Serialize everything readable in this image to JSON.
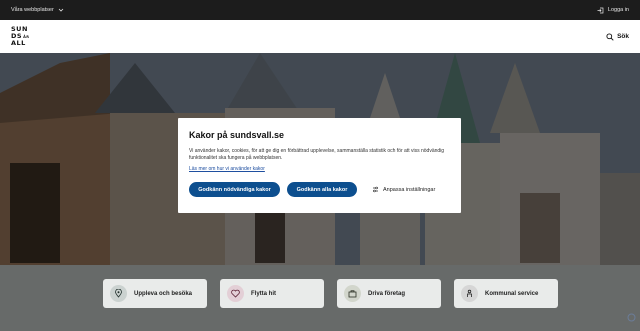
{
  "topbar": {
    "sites_label": "Våra webbplatser",
    "login_label": "Logga in"
  },
  "header": {
    "logo_lines": [
      "SUN",
      "DS",
      "ALL"
    ],
    "logo_small": "ÅR",
    "search_label": "Sök"
  },
  "modal": {
    "title": "Kakor på sundsvall.se",
    "body": "Vi använder kakor, cookies, för att ge dig en förbättrad upplevelse, sammanställa statistik och för att viss nödvändig funktionalitet ska fungera på webbplatsen.",
    "link": "Läs mer om hur vi använder kakor",
    "accept_necessary": "Godkänn nödvändiga kakor",
    "accept_all": "Godkänn alla kakor",
    "customize": "Anpassa inställningar"
  },
  "cards": [
    {
      "label": "Uppleva och besöka",
      "icon": "map-pin-icon"
    },
    {
      "label": "Flytta hit",
      "icon": "heart-home-icon"
    },
    {
      "label": "Driva företag",
      "icon": "briefcase-icon"
    },
    {
      "label": "Kommunal service",
      "icon": "service-icon"
    }
  ],
  "colors": {
    "primary_button": "#0d4f8f",
    "topbar": "#1c1c1c",
    "link": "#1f4fa0"
  }
}
